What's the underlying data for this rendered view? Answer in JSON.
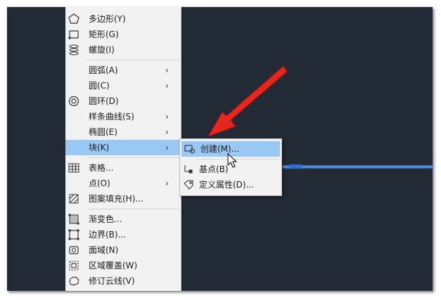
{
  "menu": {
    "items": [
      {
        "label": "多边形(Y)",
        "icon": "polygon-icon",
        "submenu": false
      },
      {
        "label": "矩形(G)",
        "icon": "rectangle-icon",
        "submenu": false
      },
      {
        "label": "螺旋(I)",
        "icon": "helix-icon",
        "submenu": false
      },
      {
        "label": "圆弧(A)",
        "icon": "",
        "submenu": true
      },
      {
        "label": "圆(C)",
        "icon": "",
        "submenu": true
      },
      {
        "label": "圆环(D)",
        "icon": "donut-icon",
        "submenu": false
      },
      {
        "label": "样条曲线(S)",
        "icon": "",
        "submenu": true
      },
      {
        "label": "椭圆(E)",
        "icon": "",
        "submenu": true
      },
      {
        "label": "块(K)",
        "icon": "",
        "submenu": true,
        "active": true
      },
      {
        "label": "表格...",
        "icon": "table-icon",
        "submenu": false
      },
      {
        "label": "点(O)",
        "icon": "",
        "submenu": true
      },
      {
        "label": "图案填充(H)...",
        "icon": "hatch-icon",
        "submenu": false
      },
      {
        "label": "渐变色...",
        "icon": "gradient-icon",
        "submenu": false
      },
      {
        "label": "边界(B)...",
        "icon": "boundary-icon",
        "submenu": false
      },
      {
        "label": "面域(N)",
        "icon": "region-icon",
        "submenu": false
      },
      {
        "label": "区域覆盖(W)",
        "icon": "wipeout-icon",
        "submenu": false
      },
      {
        "label": "修订云线(V)",
        "icon": "revcloud-icon",
        "submenu": false
      }
    ],
    "submenu_chevron": "›"
  },
  "block_submenu": {
    "items": [
      {
        "label": "创建(M)...",
        "icon": "block-create-icon",
        "active": true
      },
      {
        "label": "基点(B)",
        "icon": "base-point-icon"
      },
      {
        "label": "定义属性(D)...",
        "icon": "attribute-define-icon"
      }
    ]
  },
  "colors": {
    "canvas": "#222a36",
    "menu_bg": "#f2f2f2",
    "highlight": "#99c8f5",
    "annotation_arrow": "#e8201c",
    "drawn_line": "#4d8fe6"
  }
}
